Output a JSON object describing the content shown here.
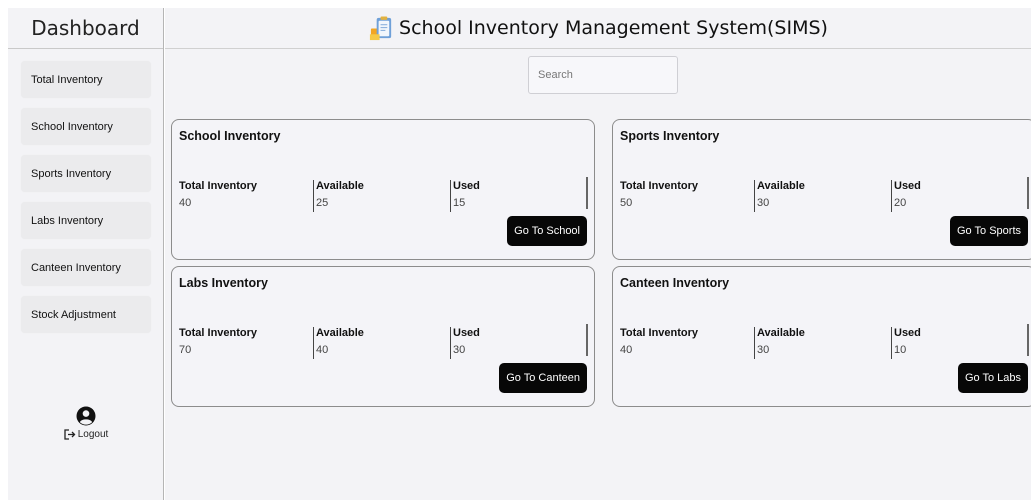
{
  "sidebar": {
    "title": "Dashboard",
    "items": [
      {
        "label": "Total Inventory"
      },
      {
        "label": "School Inventory"
      },
      {
        "label": "Sports Inventory"
      },
      {
        "label": "Labs Inventory"
      },
      {
        "label": "Canteen Inventory"
      },
      {
        "label": "Stock Adjustment"
      }
    ],
    "logout_label": "Logout"
  },
  "header": {
    "title": "School Inventory Management System(SIMS)"
  },
  "search": {
    "placeholder": "Search",
    "value": ""
  },
  "cards": [
    {
      "title": "School Inventory",
      "stats": [
        {
          "label": "Total Inventory",
          "value": "40"
        },
        {
          "label": "Available",
          "value": "25"
        },
        {
          "label": "Used",
          "value": "15"
        }
      ],
      "button": "Go To School"
    },
    {
      "title": "Sports Inventory",
      "stats": [
        {
          "label": "Total Inventory",
          "value": "50"
        },
        {
          "label": "Available",
          "value": "30"
        },
        {
          "label": "Used",
          "value": "20"
        }
      ],
      "button": "Go To Sports"
    },
    {
      "title": "Labs Inventory",
      "stats": [
        {
          "label": "Total Inventory",
          "value": "70"
        },
        {
          "label": "Available",
          "value": "40"
        },
        {
          "label": "Used",
          "value": "30"
        }
      ],
      "button": "Go To Canteen"
    },
    {
      "title": "Canteen Inventory",
      "stats": [
        {
          "label": "Total Inventory",
          "value": "40"
        },
        {
          "label": "Available",
          "value": "30"
        },
        {
          "label": "Used",
          "value": "10"
        }
      ],
      "button": "Go To Labs"
    }
  ],
  "colors": {
    "background": "#f3f3f6",
    "button": "#070707",
    "border": "#8c8c8c"
  }
}
